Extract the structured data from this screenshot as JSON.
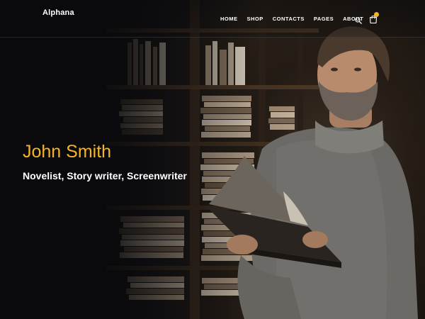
{
  "header": {
    "logo": "Alphana",
    "nav": [
      {
        "label": "HOME"
      },
      {
        "label": "SHOP"
      },
      {
        "label": "CONTACTS"
      },
      {
        "label": "PAGES"
      },
      {
        "label": "ABOUT"
      }
    ],
    "search_icon": "search-icon",
    "cart_icon": "shopping-bag-icon"
  },
  "hero": {
    "title": "John Smith",
    "subtitle": "Novelist, Story writer, Screenwriter"
  },
  "colors": {
    "accent": "#f5b32a",
    "background": "#0d0d0f",
    "text": "#ffffff"
  }
}
